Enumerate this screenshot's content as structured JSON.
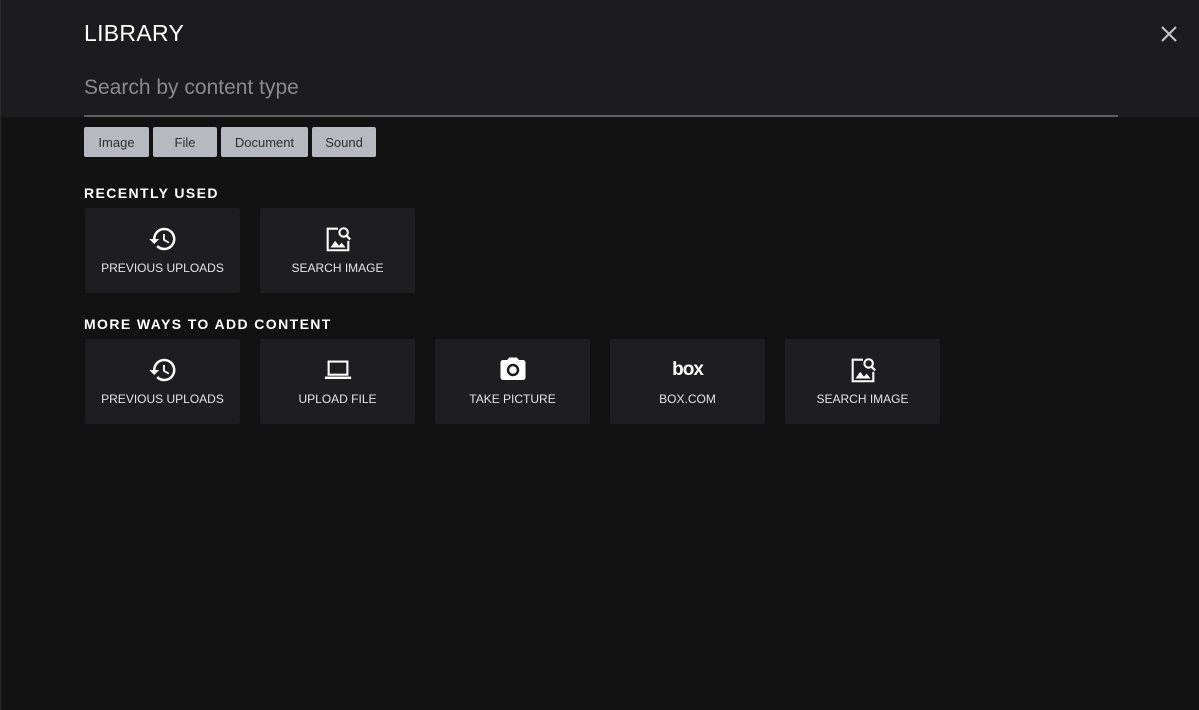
{
  "dialog": {
    "title": "LIBRARY",
    "close_icon": "close-icon"
  },
  "search": {
    "placeholder": "Search by content type",
    "value": ""
  },
  "filters": [
    {
      "label": "Image"
    },
    {
      "label": "File"
    },
    {
      "label": "Document"
    },
    {
      "label": "Sound"
    }
  ],
  "recently_used": {
    "heading": "RECENTLY USED",
    "items": [
      {
        "label": "PREVIOUS UPLOADS",
        "icon": "history-icon"
      },
      {
        "label": "SEARCH IMAGE",
        "icon": "image-search-icon"
      }
    ]
  },
  "more_ways": {
    "heading": "MORE WAYS TO ADD CONTENT",
    "items": [
      {
        "label": "PREVIOUS UPLOADS",
        "icon": "history-icon"
      },
      {
        "label": "UPLOAD FILE",
        "icon": "laptop-icon"
      },
      {
        "label": "TAKE PICTURE",
        "icon": "camera-icon"
      },
      {
        "label": "BOX.COM",
        "icon": "box-logo-icon",
        "logo_text": "box"
      },
      {
        "label": "SEARCH IMAGE",
        "icon": "image-search-icon"
      }
    ]
  },
  "colors": {
    "background": "#121212",
    "header": "#1c1c1e",
    "tile": "#1e1e20",
    "chip": "#b6b9c0"
  }
}
